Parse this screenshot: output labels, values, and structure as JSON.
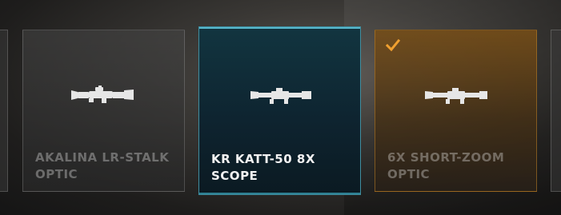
{
  "cards": [
    {
      "name": "AKALINA LR-STALK\nOPTIC",
      "state": "default",
      "icon": "scope-icon"
    },
    {
      "name": "KR KATT-50 8X\nSCOPE",
      "state": "highlighted",
      "icon": "scope-icon"
    },
    {
      "name": "6X SHORT-ZOOM\nOPTIC",
      "state": "equipped",
      "icon": "scope-icon",
      "badge_icon": "checkmark-icon"
    }
  ],
  "colors": {
    "highlight": "#57b7cc",
    "equipped": "#f0a030",
    "text_active": "#f2f2f2"
  }
}
